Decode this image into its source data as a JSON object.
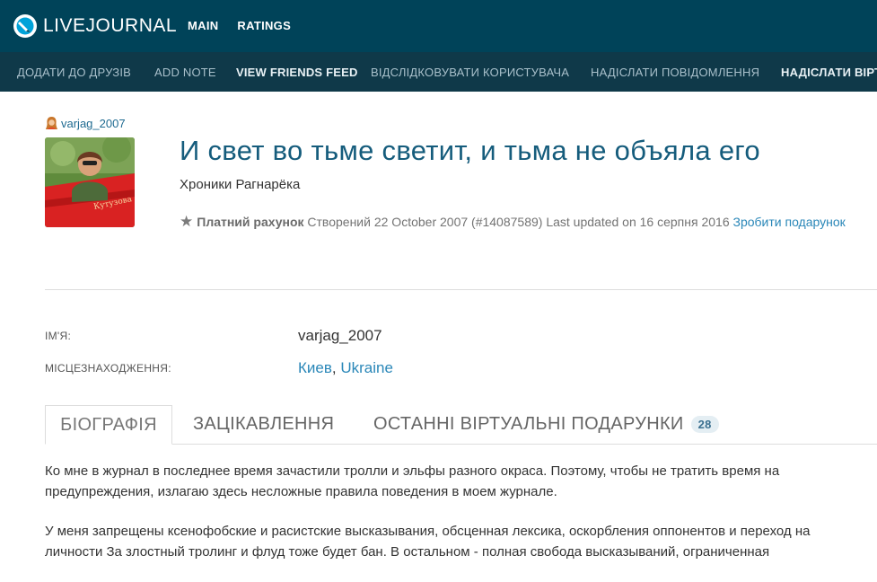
{
  "brand": {
    "name": "LIVEJOURNAL",
    "icon": "livejournal-logo-icon"
  },
  "topnav": [
    {
      "label": "MAIN"
    },
    {
      "label": "RATINGS"
    }
  ],
  "subnav": [
    {
      "label": "ДОДАТИ ДО ДРУЗІВ"
    },
    {
      "label": "ADD NOTE"
    },
    {
      "label": "VIEW FRIENDS FEED"
    },
    {
      "label": "ВІДСЛІДКОВУВАТИ КОРИСТУВАЧА"
    },
    {
      "label": "НАДІСЛАТИ ПОВІДОМЛЕННЯ"
    },
    {
      "label": "НАДІСЛАТИ ВІРТ"
    }
  ],
  "profile": {
    "username": "varjag_2007",
    "journal_title": "И свет во тьме светит, и тьма не объяла его",
    "journal_subtitle": "Хроники Рагнарёка",
    "paid_label": "Платний рахунок",
    "created_label": "Створений",
    "created_date": "22 October 2007",
    "account_id": "(#14087589)",
    "updated_label": "Last updated on",
    "updated_date": "16 серпня 2016",
    "gift_link": "Зробити подарунок"
  },
  "info": {
    "name_label": "ІМ'Я:",
    "name_value": "varjag_2007",
    "location_label": "МІСЦЕЗНАХОДЖЕННЯ:",
    "city": "Киев",
    "separator": ",",
    "country": "Ukraine"
  },
  "tabs": [
    {
      "label": "БІОГРАФІЯ",
      "active": true
    },
    {
      "label": "ЗАЦІКАВЛЕННЯ"
    },
    {
      "label": "ОСТАННІ ВІРТУАЛЬНІ ПОДАРУНКИ",
      "count": "28"
    }
  ],
  "bio": {
    "paragraph1": "Ко мне в журнал в последнее время зачастили тролли и эльфы разного окраса. Поэтому, чтобы не тратить время на предупреждения, излагаю здесь несложные правила поведения в моем журнале.",
    "paragraph2": "У меня запрещены ксенофобские и расистские высказывания, обсценная лексика, оскорбления оппонентов и переход на личности За злостный тролинг и флуд тоже будет бан. В остальном - полная свобода высказываний, ограниченная"
  },
  "colors": {
    "topbar": "#004359",
    "subbar": "#0f3949",
    "title": "#155c7c",
    "link": "#2a87b8"
  }
}
